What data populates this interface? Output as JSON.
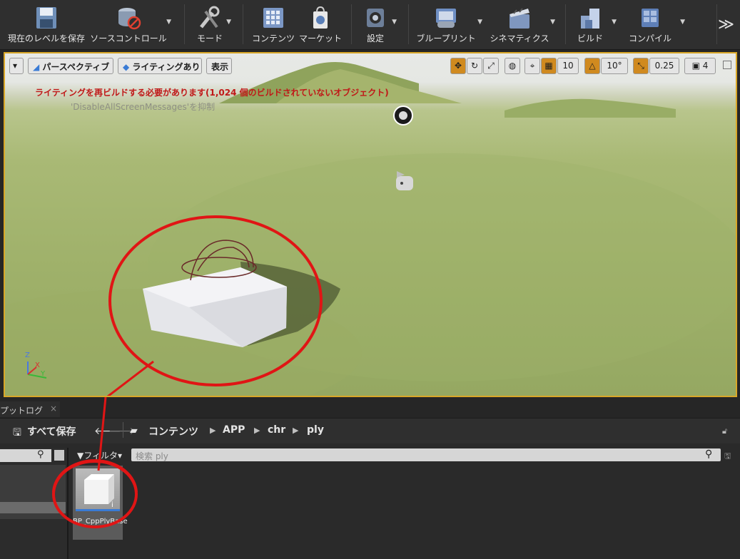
{
  "toolbar": {
    "save_current_level": "現在のレベルを保存",
    "source_control": "ソースコントロール",
    "mode": "モード",
    "content": "コンテンツ",
    "market": "マーケット",
    "settings": "設定",
    "blueprint": "ブループリント",
    "cinematics": "シネマティクス",
    "build": "ビルド",
    "compile": "コンパイル",
    "more": "≫"
  },
  "viewport": {
    "dropdown": "▾",
    "perspective": "パースペクティブ",
    "lighting": "ライティングあり",
    "show": "表示",
    "grid_snap": "10",
    "rotation_snap": "10°",
    "scale_snap": "0.25",
    "camera_speed": "4",
    "warning": "ライティングを再ビルドする必要があります(1,024 個のビルドされていないオブジェクト)",
    "suppressed": "'DisableAllScreenMessages'を抑制",
    "axis_z": "Z",
    "axis_y": "Y",
    "axis_x": "X"
  },
  "log_tab": {
    "label": "プットログ",
    "close": "×"
  },
  "content_browser": {
    "save_all": "すべて保存",
    "breadcrumb": [
      "コンテンツ",
      "APP",
      "chr",
      "ply"
    ],
    "filter": "フィルタ",
    "search_placeholder": "検索 ply",
    "asset_name": "BP_CppPlyBase"
  },
  "colors": {
    "highlight_circle": "#e01515",
    "viewport_border": "#d9a728",
    "accent_blue": "#3a7bd5"
  }
}
